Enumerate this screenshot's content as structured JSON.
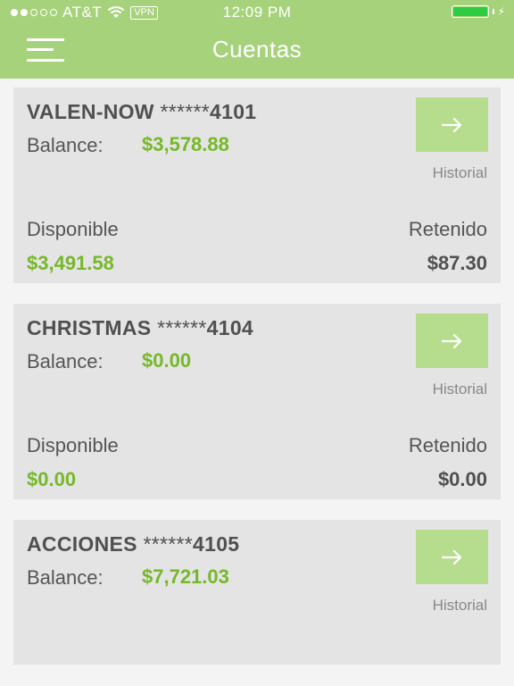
{
  "status_bar": {
    "carrier": "AT&T",
    "vpn": "VPN",
    "time": "12:09 PM",
    "battery_level": 1.0
  },
  "header": {
    "title": "Cuentas",
    "menu_icon": "hamburger-menu-icon",
    "background": "#a7d27c"
  },
  "labels": {
    "balance": "Balance:",
    "historial": "Historial",
    "disponible": "Disponible",
    "retenido": "Retenido",
    "mask": "******"
  },
  "accounts": [
    {
      "name": "VALEN-NOW",
      "number": "4101",
      "balance": "$3,578.88",
      "disponible": "$3,491.58",
      "retenido": "$87.30"
    },
    {
      "name": "CHRISTMAS",
      "number": "4104",
      "balance": "$0.00",
      "disponible": "$0.00",
      "retenido": "$0.00"
    },
    {
      "name": "ACCIONES",
      "number": "4105",
      "balance": "$7,721.03"
    }
  ],
  "colors": {
    "accent_green": "#76b82a",
    "button_green": "#b6dd8d",
    "card_bg": "#e4e4e4"
  }
}
